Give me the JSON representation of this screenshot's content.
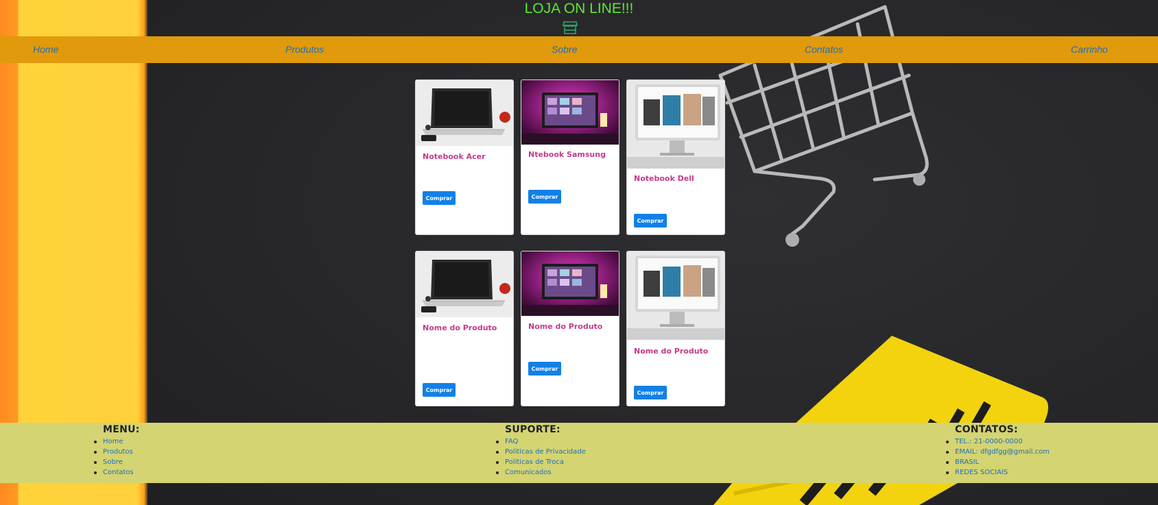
{
  "header": {
    "title": "LOJA ON LINE!!!",
    "title_color": "#5de82c"
  },
  "nav": {
    "background": "#e19a0b",
    "items": [
      {
        "label": "Home"
      },
      {
        "label": "Produtos"
      },
      {
        "label": "Sobre"
      },
      {
        "label": "Contatos"
      },
      {
        "label": "Carrinho"
      }
    ]
  },
  "products": {
    "buy_label": "Comprar",
    "rows": [
      [
        {
          "name": "Notebook Acer",
          "image": "laptop-with-apple"
        },
        {
          "name": "Ntebook Samsung",
          "image": "pink-lit-monitor"
        },
        {
          "name": "Notebook Dell",
          "image": "imac-gallery"
        }
      ],
      [
        {
          "name": "Nome do Produto",
          "image": "laptop-with-apple"
        },
        {
          "name": "Nome do Produto",
          "image": "pink-lit-monitor"
        },
        {
          "name": "Nome do Produto",
          "image": "imac-gallery"
        }
      ]
    ]
  },
  "footer": {
    "background": "#d4d472",
    "menu": {
      "heading": "MENU:",
      "items": [
        "Home",
        "Produtos",
        "Sobre",
        "Contatos"
      ]
    },
    "suporte": {
      "heading": "SUPORTE:",
      "items": [
        "FAQ",
        "Politicas de Privacidade",
        "Politicas de Troca",
        "Comunicados"
      ]
    },
    "contatos": {
      "heading": "CONTATOS:",
      "items": [
        "TEL.: 21-0000-0000",
        "EMAIL: dfgdfgg@gmail.com",
        "BRASIL",
        "REDES SOCIAIS"
      ]
    }
  }
}
